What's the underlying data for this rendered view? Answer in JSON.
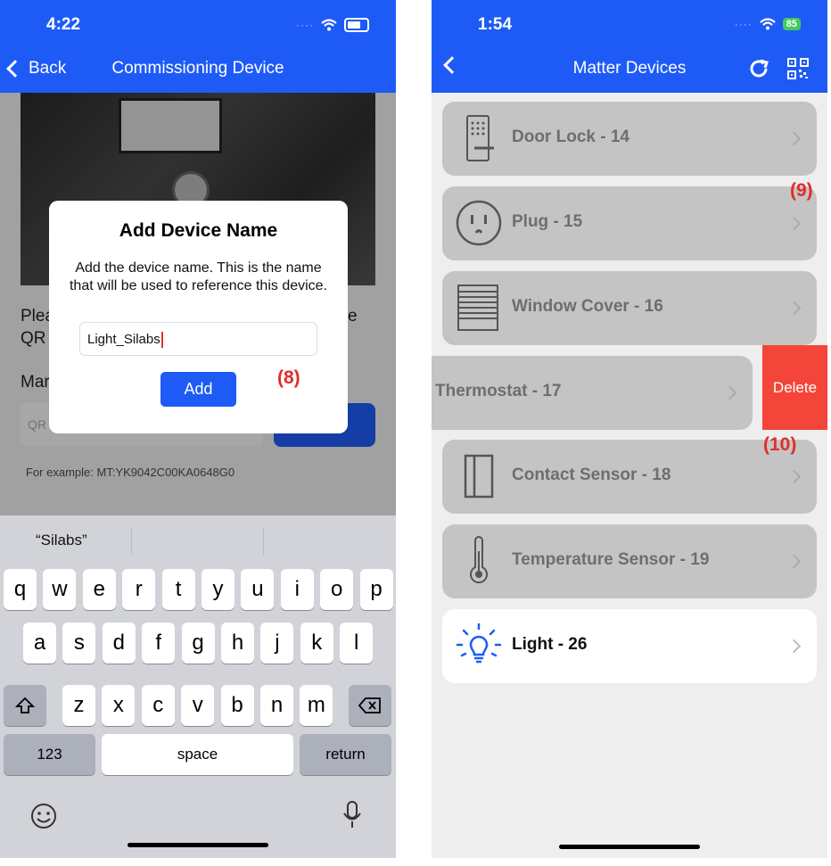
{
  "left_screen": {
    "status": {
      "time": "4:22"
    },
    "nav": {
      "back_label": "Back",
      "title": "Commissioning Device"
    },
    "background": {
      "instruction_partial_1": "Plea",
      "instruction_partial_2": "QR",
      "instruction_partial_end": "e",
      "manual_partial": "Mar",
      "input_placeholder_partial": "QR",
      "example": "For example: MT:YK9042C00KA0648G0"
    },
    "dialog": {
      "title": "Add Device Name",
      "message": "Add the device name. This is the name that will be used to reference this device.",
      "input_value": "Light_Silabs",
      "add_label": "Add"
    },
    "annotation": "(8)",
    "keyboard": {
      "suggestion": "“Silabs”",
      "row1": [
        "q",
        "w",
        "e",
        "r",
        "t",
        "y",
        "u",
        "i",
        "o",
        "p"
      ],
      "row2": [
        "a",
        "s",
        "d",
        "f",
        "g",
        "h",
        "j",
        "k",
        "l"
      ],
      "row3": [
        "z",
        "x",
        "c",
        "v",
        "b",
        "n",
        "m"
      ],
      "numbers_label": "123",
      "space_label": "space",
      "return_label": "return"
    }
  },
  "right_screen": {
    "status": {
      "time": "1:54",
      "battery": "85"
    },
    "nav": {
      "title": "Matter Devices"
    },
    "devices": [
      {
        "label": "Door Lock - 14",
        "icon": "door-lock-icon"
      },
      {
        "label": "Plug - 15",
        "icon": "plug-icon"
      },
      {
        "label": "Window Cover - 16",
        "icon": "window-cover-icon"
      },
      {
        "label": "Thermostat - 17",
        "icon": "thermostat-icon"
      },
      {
        "label": "Contact Sensor - 18",
        "icon": "contact-sensor-icon"
      },
      {
        "label": "Temperature Sensor - 19",
        "icon": "thermometer-icon"
      },
      {
        "label": "Light - 26",
        "icon": "light-bulb-icon"
      }
    ],
    "delete_label": "Delete",
    "annotations": [
      "(9)",
      "(10)"
    ]
  },
  "colors": {
    "primary": "#1e5bf6",
    "delete": "#f4453a",
    "annotation": "#e32b2b",
    "light_icon": "#1e5bf6"
  }
}
